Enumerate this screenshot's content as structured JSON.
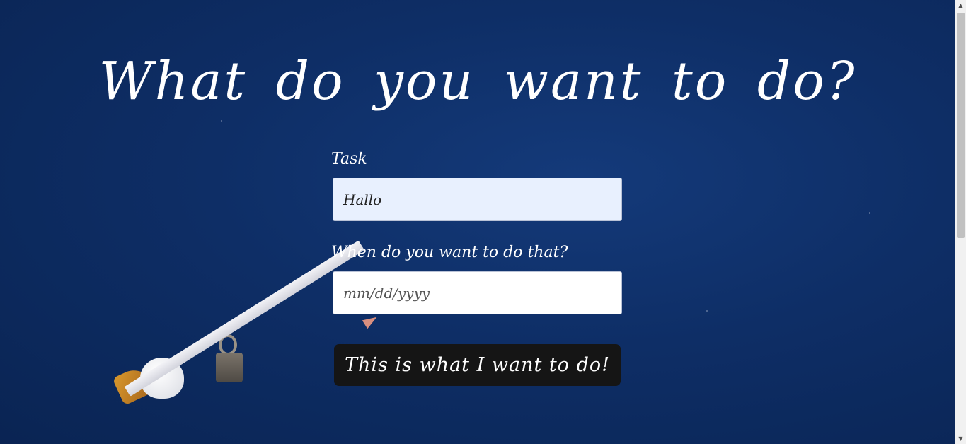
{
  "heading": "What do you want to do?",
  "form": {
    "task_label": "Task",
    "task_value": "Hallo",
    "date_label": "When do you want to do that?",
    "date_placeholder": "mm/dd/yyyy",
    "submit_label": "This is what I want to do!"
  },
  "scrollbar": {
    "up_icon": "scroll-up-arrow",
    "down_icon": "scroll-down-arrow"
  }
}
